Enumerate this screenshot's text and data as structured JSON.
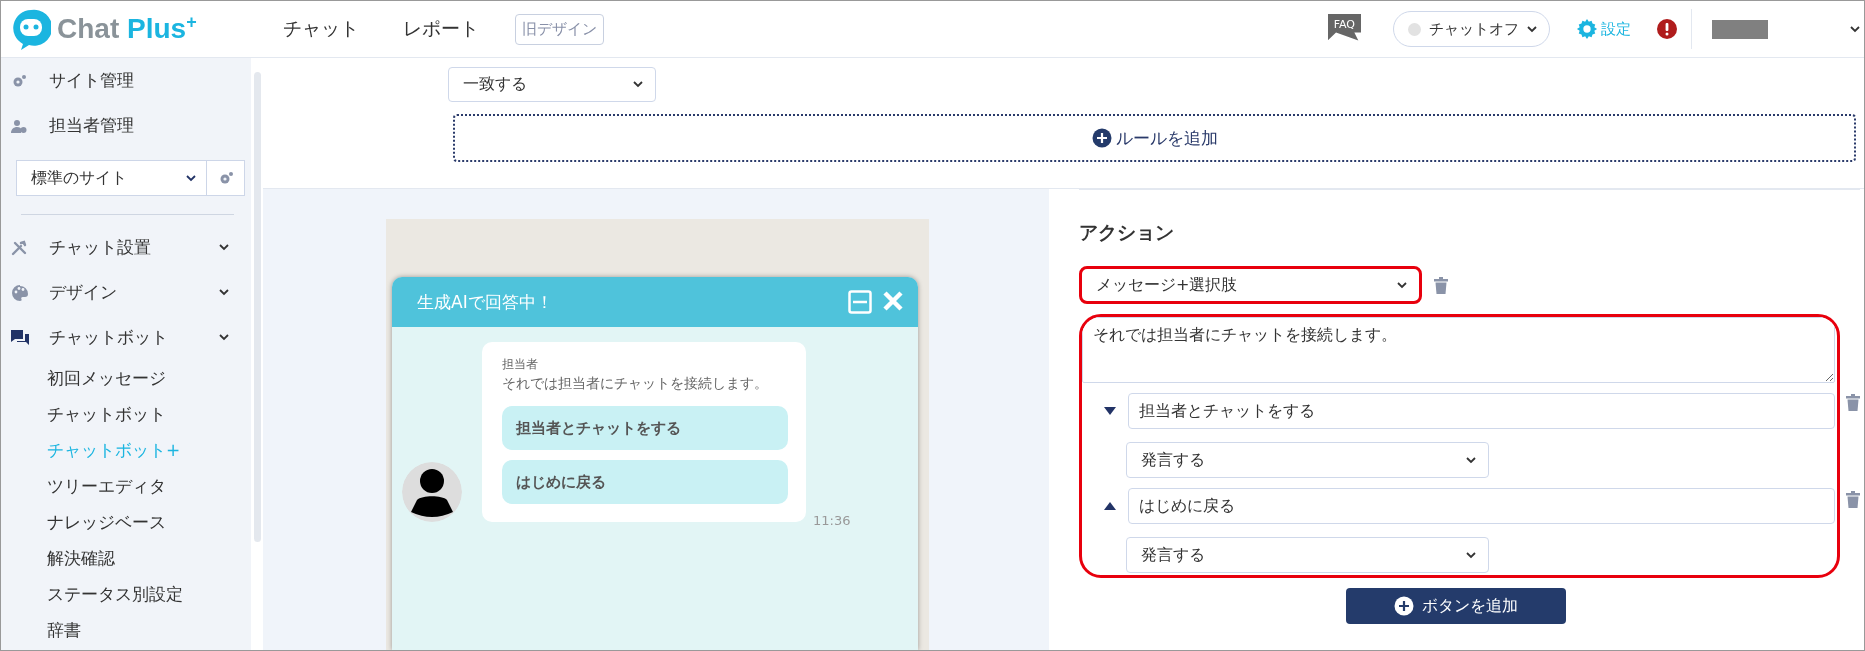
{
  "header": {
    "logo": {
      "text": "Chat",
      "accent": "Plus",
      "sup": "+"
    },
    "nav": [
      {
        "label": "チャット"
      },
      {
        "label": "レポート"
      }
    ],
    "old_design_button": "旧デザイン",
    "faq_label": "FAQ",
    "status_select": {
      "value": "チャットオフ",
      "online": false
    },
    "settings_link": "設定"
  },
  "sidebar": {
    "top_items": [
      {
        "label": "サイト管理"
      },
      {
        "label": "担当者管理"
      }
    ],
    "site_select": "標準のサイト",
    "menu": [
      {
        "label": "チャット設置"
      },
      {
        "label": "デザイン"
      },
      {
        "label": "チャットボット",
        "children": [
          {
            "label": "初回メッセージ",
            "selected": false
          },
          {
            "label": "チャットボット",
            "selected": false
          },
          {
            "label": "チャットボット+",
            "selected": true
          },
          {
            "label": "ツリーエディタ",
            "selected": false
          },
          {
            "label": "ナレッジベース",
            "selected": false
          },
          {
            "label": "解決確認",
            "selected": false
          },
          {
            "label": "ステータス別設定",
            "selected": false
          },
          {
            "label": "辞書",
            "selected": false
          }
        ]
      }
    ]
  },
  "rules": {
    "match_select": "一致する",
    "add_rule_button": "ルールを追加"
  },
  "preview": {
    "title": "生成AIで回答中！",
    "message": {
      "sender": "担当者",
      "text": "それでは担当者にチャットを接続します。",
      "choices": [
        "担当者とチャットをする",
        "はじめに戻る"
      ],
      "time": "11:36"
    }
  },
  "action": {
    "heading": "アクション",
    "type_select": {
      "value": "メッセージ+選択肢",
      "highlighted": true
    },
    "message_group": {
      "highlighted": true,
      "text": "それでは担当者にチャットを接続します。",
      "buttons": [
        {
          "label": "担当者とチャットをする",
          "kind": "down",
          "action": "発言する"
        },
        {
          "label": "はじめに戻る",
          "kind": "up",
          "action": "発言する"
        }
      ]
    },
    "add_button": "ボタンを追加"
  }
}
